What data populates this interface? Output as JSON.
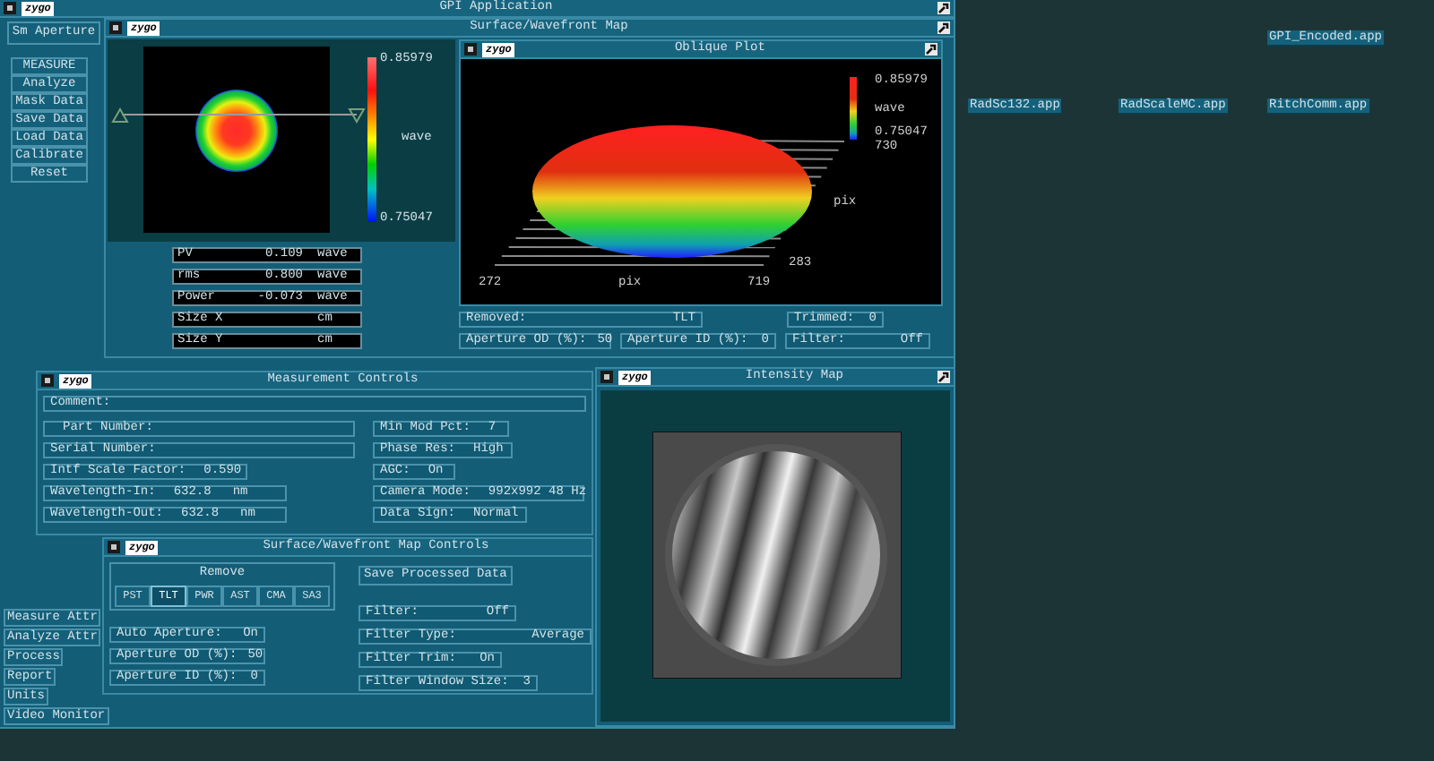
{
  "desktop_icons": [
    {
      "label": "GPI_Encoded.app"
    },
    {
      "label": "RadSc132.app"
    },
    {
      "label": "RadScaleMC.app"
    },
    {
      "label": "RitchComm.app"
    }
  ],
  "app_window": {
    "title": "GPI Application",
    "logo": "zygo",
    "aperture_label": "Sm Aperture",
    "buttons": [
      "MEASURE",
      "Analyze",
      "Mask Data",
      "Save Data",
      "Load Data",
      "Calibrate",
      "Reset"
    ],
    "attribute_buttons": [
      "Measure Attr",
      "Analyze Attr",
      "Process",
      "Report",
      "Units",
      "Video Monitor"
    ]
  },
  "surface_map": {
    "title": "Surface/Wavefront Map",
    "logo": "zygo",
    "colorbar": {
      "max": "0.85979",
      "unit": "wave",
      "min": "0.75047"
    },
    "results": [
      {
        "label": "PV",
        "value": "0.109",
        "unit": "wave"
      },
      {
        "label": "rms",
        "value": "0.800",
        "unit": "wave"
      },
      {
        "label": "Power",
        "value": "-0.073",
        "unit": "wave"
      },
      {
        "label": "Size X",
        "unit": "cm"
      },
      {
        "label": "Size Y",
        "unit": "cm"
      }
    ],
    "oblique_plot": {
      "title": "Oblique Plot",
      "logo": "zygo",
      "scale_max": "0.85979",
      "scale_unit": "wave",
      "scale_min": "0.75047",
      "scale_extra": "730",
      "x_min": "272",
      "x_label": "pix",
      "x_max": "719",
      "y_label": "pix",
      "y_max": "283"
    },
    "status": [
      {
        "label": "Removed:",
        "value": "TLT"
      },
      {
        "label": "Trimmed:",
        "value": "0"
      },
      {
        "label": "Aperture OD (%):",
        "value": "50"
      },
      {
        "label": "Aperture ID (%):",
        "value": "0"
      },
      {
        "label": "Filter:",
        "value": "Off"
      }
    ]
  },
  "measurement_controls": {
    "title": "Measurement Controls",
    "logo": "zygo",
    "comment_label": "Comment:",
    "left_fields": [
      {
        "label": "Part Number:"
      },
      {
        "label": "Serial Number:"
      },
      {
        "label": "Intf Scale Factor:",
        "value": "0.590"
      },
      {
        "label": "Wavelength-In:",
        "value": "632.8",
        "unit": "nm"
      },
      {
        "label": "Wavelength-Out:",
        "value": "632.8",
        "unit": "nm"
      }
    ],
    "right_fields": [
      {
        "label": "Min Mod Pct:",
        "value": "7"
      },
      {
        "label": "Phase Res:",
        "value": "High"
      },
      {
        "label": "AGC:",
        "value": "On"
      },
      {
        "label": "Camera Mode:",
        "value": "992x992 48 Hz"
      },
      {
        "label": "Data Sign:",
        "value": "Normal"
      }
    ]
  },
  "intensity_map": {
    "title": "Intensity Map",
    "logo": "zygo"
  },
  "map_controls": {
    "title": "Surface/Wavefront Map Controls",
    "logo": "zygo",
    "remove_label": "Remove",
    "remove_options": [
      {
        "label": "PST",
        "selected": false
      },
      {
        "label": "TLT",
        "selected": true
      },
      {
        "label": "PWR",
        "selected": false
      },
      {
        "label": "AST",
        "selected": false
      },
      {
        "label": "CMA",
        "selected": false
      },
      {
        "label": "SA3",
        "selected": false
      }
    ],
    "save_button": "Save Processed Data",
    "left_fields": [
      {
        "label": "Auto Aperture:",
        "value": "On"
      },
      {
        "label": "Aperture OD (%):",
        "value": "50"
      },
      {
        "label": "Aperture ID (%):",
        "value": "0"
      }
    ],
    "right_fields": [
      {
        "label": "Filter:",
        "value": "Off"
      },
      {
        "label": "Filter Type:",
        "value": "Average"
      },
      {
        "label": "Filter Trim:",
        "value": "On"
      },
      {
        "label": "Filter Window Size:",
        "value": "3"
      }
    ]
  }
}
